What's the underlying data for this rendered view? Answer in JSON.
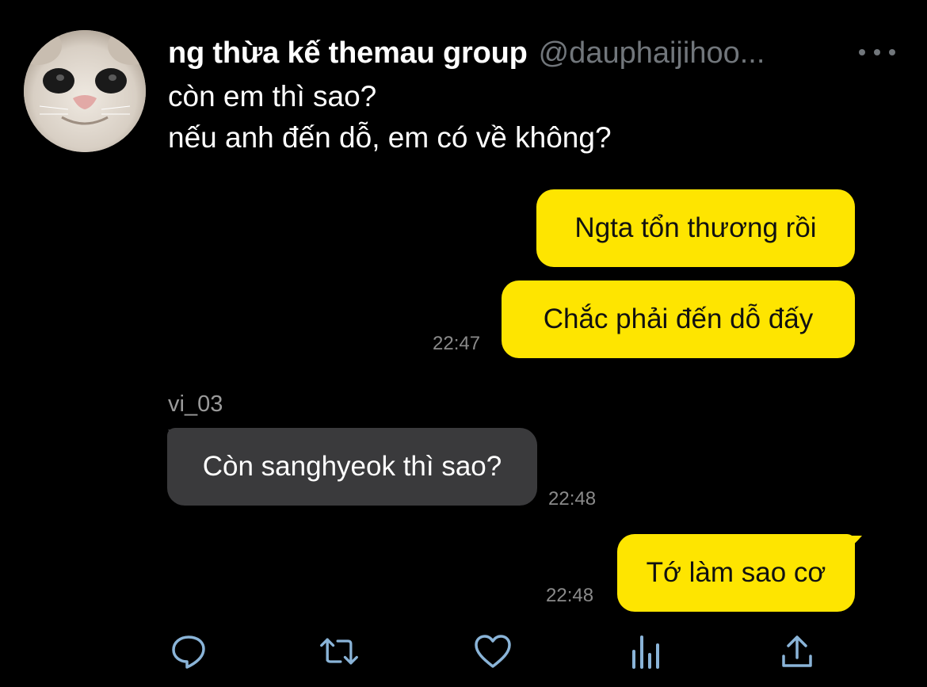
{
  "tweet": {
    "display_name": "ng thừa kế themau group",
    "handle": "@dauphaijihoo...",
    "text_lines": [
      "còn em thì sao?",
      "nếu anh đến dỗ, em có về không?"
    ]
  },
  "chat": {
    "messages": [
      {
        "side": "right",
        "text": "Ngta tổn thương rồi"
      },
      {
        "side": "right",
        "text": "Chắc phải đến dỗ đấy",
        "time": "22:47"
      },
      {
        "side": "left",
        "sender": "vi_03",
        "text": "Còn sanghyeok thì sao?",
        "time": "22:48"
      },
      {
        "side": "right",
        "text": "Tớ làm sao cơ",
        "time": "22:48"
      }
    ]
  },
  "colors": {
    "background": "#000000",
    "outgoing_bubble": "#fee500",
    "incoming_bubble": "#3a3a3c",
    "secondary_text": "#71767b",
    "action_icon": "#8ab4d8"
  },
  "icons": {
    "more": "more-horizontal-icon",
    "reply": "reply-icon",
    "retweet": "retweet-icon",
    "like": "like-icon",
    "views": "views-icon",
    "share": "share-icon"
  }
}
